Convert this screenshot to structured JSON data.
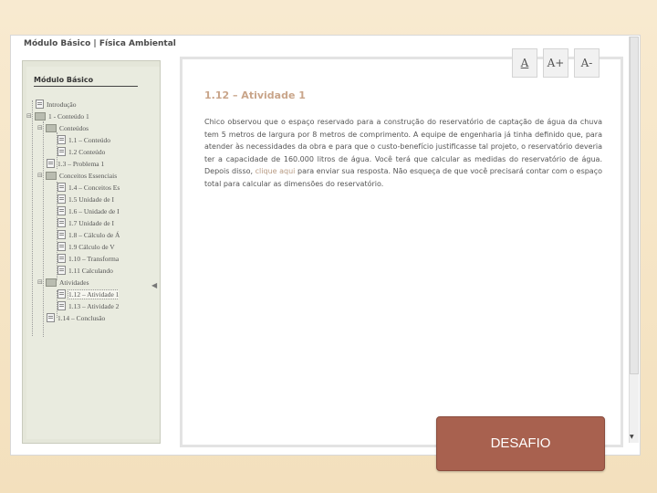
{
  "header": {
    "title": "Módulo Básico | Física Ambiental"
  },
  "sidebar": {
    "title": "Módulo Básico",
    "items": [
      "Introdução",
      "1 - Conteúdo 1",
      "Conteúdos",
      "1.1 – Conteúdo",
      "1.2    Conteúdo",
      "1.3 – Problema 1",
      "Conceitos Essenciais",
      "1.4 – Conceitos Es",
      "1.5    Unidade de I",
      "1.6 – Unidade de I",
      "1.7    Unidade de I",
      "1.8 – Cálculo de Á",
      "1.9    Cálculo de V",
      "1.10 – Transforma",
      "1.11    Calculando",
      "Atividades",
      "1.12 – Atividade 1",
      "1.13 – Atividade 2",
      "1.14 – Conclusão"
    ]
  },
  "toolbar": {
    "font_reset": "A",
    "font_increase": "A+",
    "font_decrease": "A-"
  },
  "activity": {
    "title": "1.12 – Atividade 1",
    "body_before": "Chico observou que o espaço reservado para a construção do reservatório de captação de água da chuva tem 5 metros de largura por 8 metros de comprimento. A equipe de engenharia já tinha definido que, para atender às necessidades da obra e para que o custo-benefício justificasse tal projeto, o reservatório deveria ter a capacidade de 160.000 litros de água. Você terá que calcular as medidas do reservatório de água. Depois disso, ",
    "link_text": "clique aqui",
    "body_after": " para enviar sua resposta. Não esqueça de que você precisará contar com o espaço total para calcular as dimensões do reservatório."
  },
  "desafio": {
    "label": "DESAFIO"
  },
  "colors": {
    "desafio": "#a8614f",
    "title_accent": "#c9a58a",
    "link": "#b79a82"
  }
}
